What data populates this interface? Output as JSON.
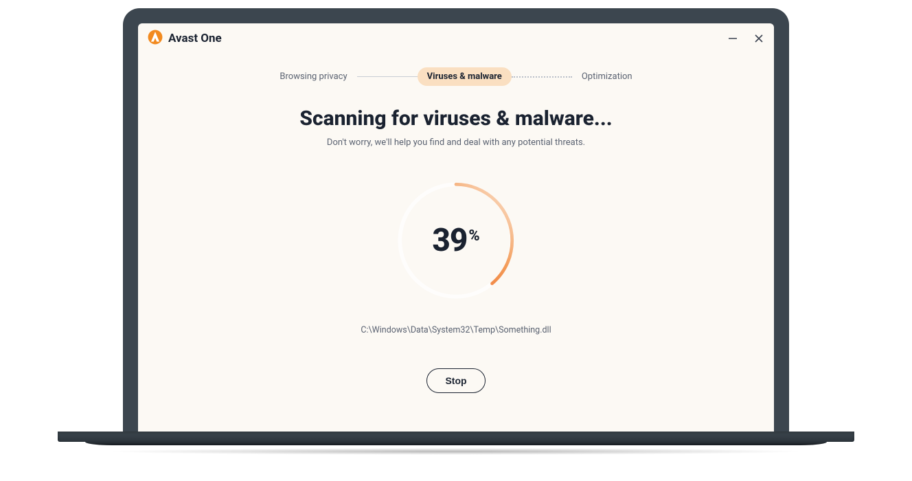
{
  "brand": {
    "name": "Avast One"
  },
  "window": {
    "minimize_label": "Minimize",
    "close_label": "Close"
  },
  "stepper": {
    "items": [
      {
        "label": "Browsing privacy"
      },
      {
        "label": "Viruses & malware"
      },
      {
        "label": "Optimization"
      }
    ],
    "active_index": 1
  },
  "scan": {
    "title": "Scanning for viruses & malware...",
    "subtitle": "Don't worry, we'll help you find and deal with any potential threats.",
    "percent": 39,
    "percent_symbol": "%",
    "current_file": "C:\\Windows\\Data\\System32\\Temp\\Something.dll"
  },
  "actions": {
    "stop_label": "Stop"
  },
  "colors": {
    "accent_start": "#f06a2a",
    "accent_end": "#f7c9a8",
    "bg": "#fcf9f4",
    "text": "#1a2230",
    "muted": "#5a6271",
    "pill": "#fadfc1"
  }
}
